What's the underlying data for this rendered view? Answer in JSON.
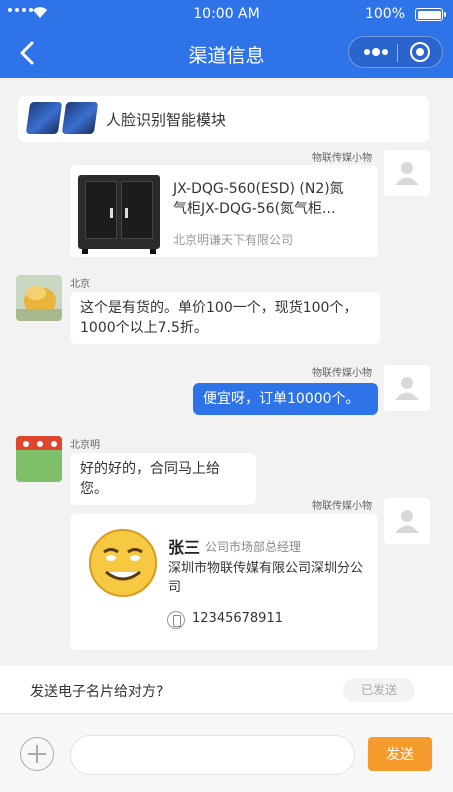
{
  "status_bar": {
    "time": "10:00 AM",
    "battery_pct": "100%"
  },
  "nav": {
    "title": "渠道信息"
  },
  "product_top": {
    "text": "人脸识别智能模块"
  },
  "messages": {
    "product_card": {
      "sender": "物联传媒小物",
      "name": "JX-DQG-560(ESD) (N2)氮气柜JX-DQG-56(氮气柜...",
      "shop": "北京明谦天下有限公司"
    },
    "reply1": {
      "sender": "北京",
      "text": "这个是有货的。单价100一个，现货100个，1000个以上7.5折。"
    },
    "out1": {
      "sender": "物联传媒小物",
      "text": "便宜呀，订单10000个。"
    },
    "reply2": {
      "sender": "北京明",
      "text": "好的好的，合同马上给您。"
    },
    "business_card": {
      "sender": "物联传媒小物",
      "name": "张三",
      "title": "公司市场部总经理",
      "company": "深圳市物联传媒有限公司深圳分公司",
      "phone": "12345678911"
    }
  },
  "confirm": {
    "question": "发送电子名片给对方?",
    "status": "已发送"
  },
  "input": {
    "placeholder": "",
    "send_label": "发送"
  }
}
